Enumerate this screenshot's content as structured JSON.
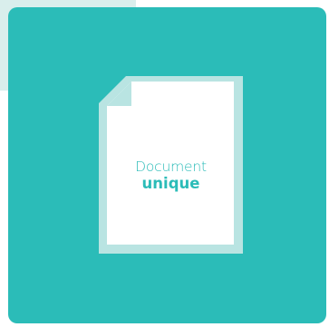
{
  "colors": {
    "card": "#2bbcb8",
    "document_fill": "#ffffff",
    "document_shadow": "#b9e4e2",
    "accent_text": "#2bbcb8"
  },
  "document": {
    "icon": "document-icon",
    "line1": "Document",
    "line2": "unique"
  }
}
